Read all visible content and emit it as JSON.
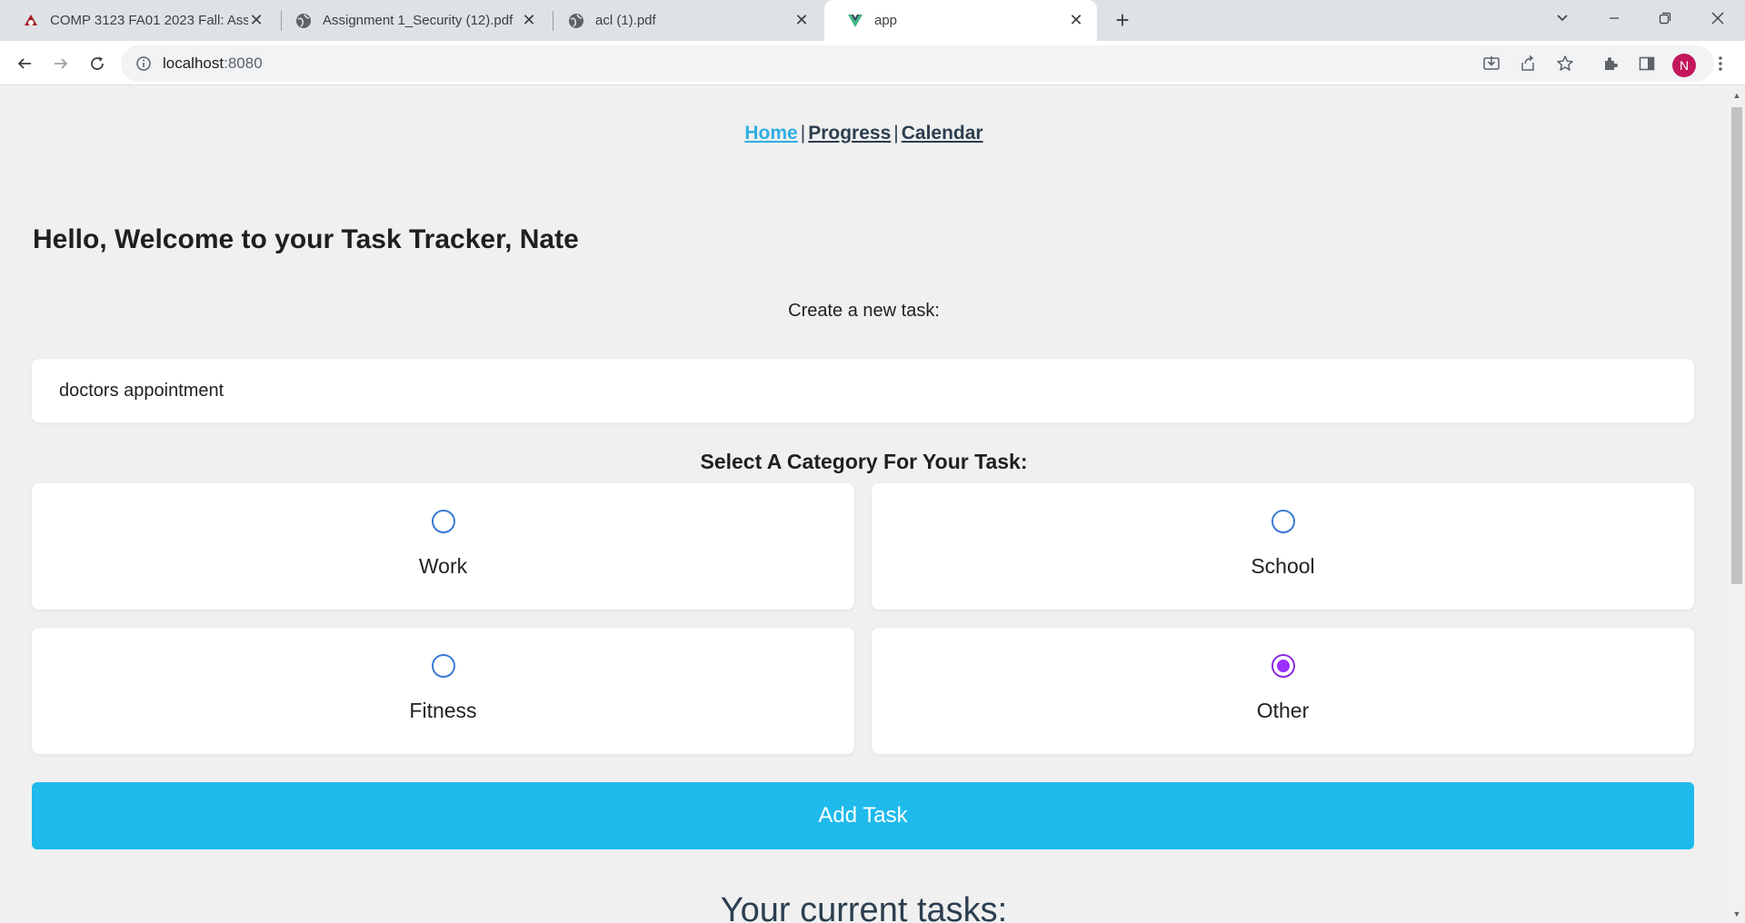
{
  "browser": {
    "tabs": [
      {
        "title": "COMP 3123 FA01 2023 Fall: Assi",
        "icon": "brand-icon",
        "active": false
      },
      {
        "title": "Assignment 1_Security (12).pdf",
        "icon": "globe-icon",
        "active": false
      },
      {
        "title": "acl (1).pdf",
        "icon": "globe-icon",
        "active": false
      },
      {
        "title": "app",
        "icon": "vue-icon",
        "active": true
      }
    ],
    "url_host": "localhost",
    "url_port": ":8080",
    "profile_initial": "N"
  },
  "page": {
    "nav": {
      "home": "Home",
      "progress": "Progress",
      "calendar": "Calendar",
      "separator": "|"
    },
    "welcome": "Hello, Welcome to your Task Tracker, Nate",
    "create_label": "Create a new task:",
    "task_input_value": "doctors appointment",
    "category_heading": "Select A Category For Your Task:",
    "categories": [
      {
        "label": "Work",
        "selected": false
      },
      {
        "label": "School",
        "selected": false
      },
      {
        "label": "Fitness",
        "selected": false
      },
      {
        "label": "Other",
        "selected": true
      }
    ],
    "add_button": "Add Task",
    "current_tasks_heading": "Your current tasks:"
  },
  "colors": {
    "accent_button": "#1fbaec",
    "active_link": "#2eaee0",
    "selected_radio": "#9b30ff"
  }
}
